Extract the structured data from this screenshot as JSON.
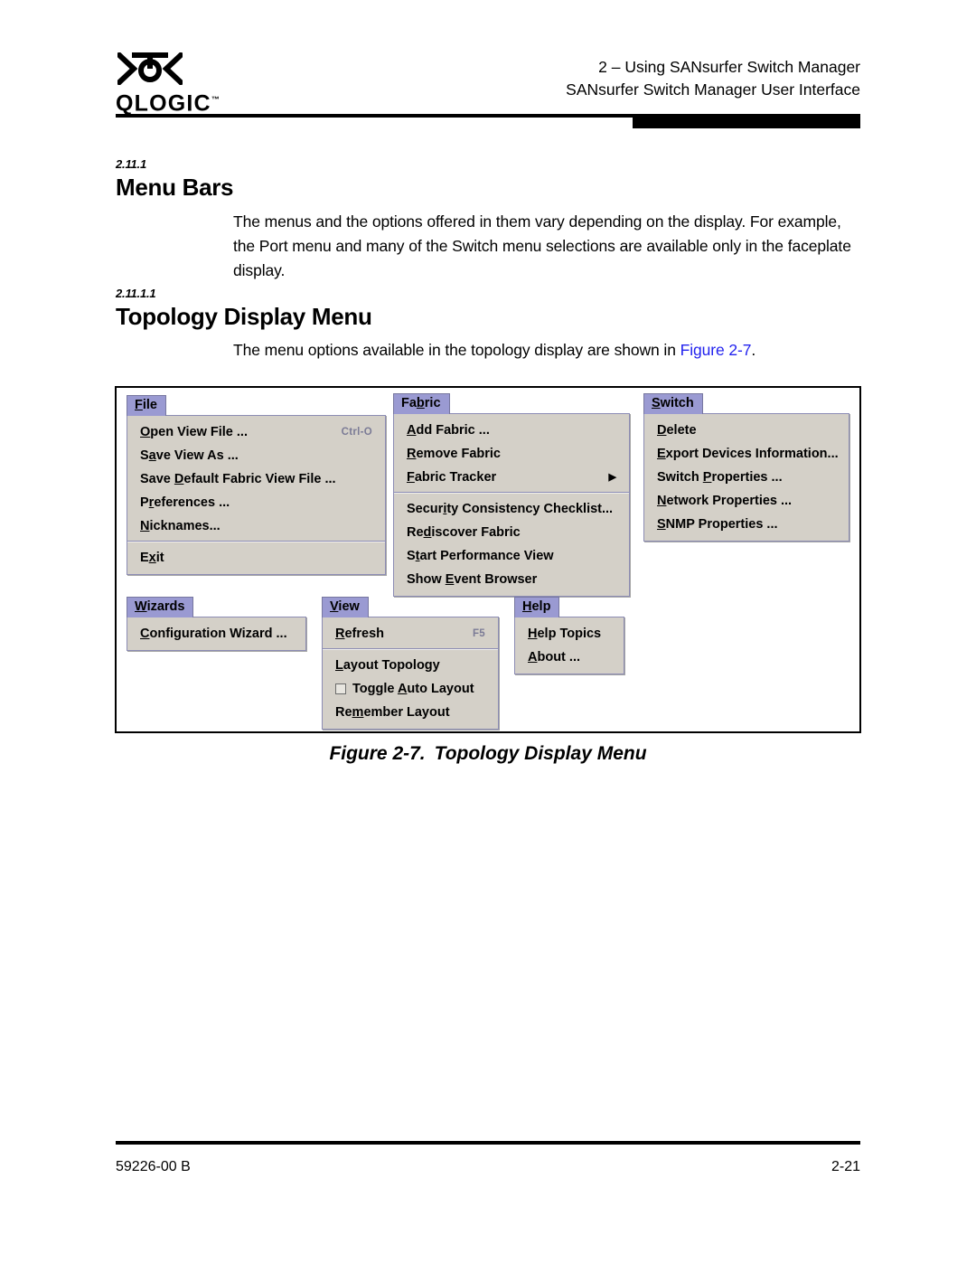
{
  "header": {
    "logo_word": "QLOGIC",
    "logo_tm": "™",
    "line1": "2 – Using SANsurfer Switch Manager",
    "line2": "SANsurfer Switch Manager User Interface"
  },
  "sections": [
    {
      "number": "2.11.1",
      "title": "Menu Bars",
      "body": "The menus and the options offered in them vary depending on the display. For example, the Port menu and many of the Switch menu selections are available only in the faceplate display."
    },
    {
      "number": "2.11.1.1",
      "title": "Topology Display Menu",
      "body_before": "The menu options available in the topology display are shown in ",
      "body_link": "Figure 2-7",
      "body_after": "."
    }
  ],
  "figure": {
    "caption_number": "Figure 2-7.",
    "caption_title": "Topology Display Menu",
    "menus": [
      {
        "name": "File",
        "title": "File",
        "items": [
          {
            "label": "Open View File ...",
            "accel": "Ctrl-O",
            "mnemonic": "O"
          },
          {
            "label": "Save View As ...",
            "mnemonic": "a"
          },
          {
            "label": "Save Default Fabric View File ...",
            "mnemonic": "D"
          },
          {
            "label": "Preferences ...",
            "mnemonic": "r"
          },
          {
            "label": "Nicknames...",
            "mnemonic": "N"
          },
          {
            "separator": true
          },
          {
            "label": "Exit",
            "mnemonic": "x"
          }
        ]
      },
      {
        "name": "Fabric",
        "title": "Fabric",
        "items": [
          {
            "label": "Add Fabric ...",
            "mnemonic": "A"
          },
          {
            "label": "Remove Fabric",
            "mnemonic": "R"
          },
          {
            "label": "Fabric Tracker",
            "submenu": true,
            "mnemonic": "F"
          },
          {
            "separator": true
          },
          {
            "label": "Security Consistency Checklist...",
            "mnemonic": "i"
          },
          {
            "label": "Rediscover Fabric",
            "mnemonic": "d"
          },
          {
            "label": "Start Performance View",
            "mnemonic": "t"
          },
          {
            "label": "Show Event Browser",
            "mnemonic": "E"
          }
        ]
      },
      {
        "name": "Switch",
        "title": "Switch",
        "items": [
          {
            "label": "Delete",
            "mnemonic": "D"
          },
          {
            "label": "Export Devices Information...",
            "mnemonic": "E"
          },
          {
            "label": "Switch Properties ...",
            "mnemonic": "P"
          },
          {
            "label": "Network Properties ...",
            "mnemonic": "N"
          },
          {
            "label": "SNMP Properties ...",
            "mnemonic": "S"
          }
        ]
      },
      {
        "name": "Wizards",
        "title": "Wizards",
        "items": [
          {
            "label": "Configuration Wizard ...",
            "mnemonic": "C"
          }
        ]
      },
      {
        "name": "View",
        "title": "View",
        "items": [
          {
            "label": "Refresh",
            "accel": "F5",
            "mnemonic": "R"
          },
          {
            "separator": true
          },
          {
            "label": "Layout Topology",
            "mnemonic": "L"
          },
          {
            "label": "Toggle Auto Layout",
            "checkbox": true,
            "checked": false,
            "mnemonic": "A"
          },
          {
            "label": "Remember Layout",
            "mnemonic": "m"
          }
        ]
      },
      {
        "name": "Help",
        "title": "Help",
        "items": [
          {
            "label": "Help Topics",
            "mnemonic": "H"
          },
          {
            "label": "About ...",
            "mnemonic": "A"
          }
        ]
      }
    ]
  },
  "footer": {
    "doc_number": "59226-00 B",
    "page_number": "2-21"
  }
}
